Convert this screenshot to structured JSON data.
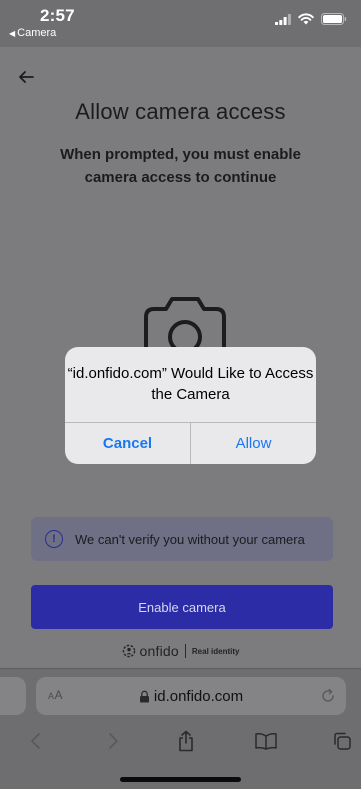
{
  "status_bar": {
    "time": "2:57",
    "back_app": "Camera"
  },
  "page": {
    "title": "Allow camera access",
    "subtitle": "When prompted, you must enable camera access to continue",
    "notice": {
      "icon": "exclamation-icon",
      "text": "We can't verify you without your camera"
    },
    "enable_button_label": "Enable camera",
    "branding": {
      "name": "onfido",
      "tagline": "Real identity"
    }
  },
  "alert": {
    "title": "“id.onfido.com” Would Like to Access the Camera",
    "cancel_label": "Cancel",
    "allow_label": "Allow"
  },
  "browser": {
    "aa_label_small": "A",
    "aa_label_large": "A",
    "url": "id.onfido.com"
  },
  "colors": {
    "primary_button": "#2c2da6",
    "alert_action": "#1778f2",
    "notice_background": "#6f7085"
  }
}
